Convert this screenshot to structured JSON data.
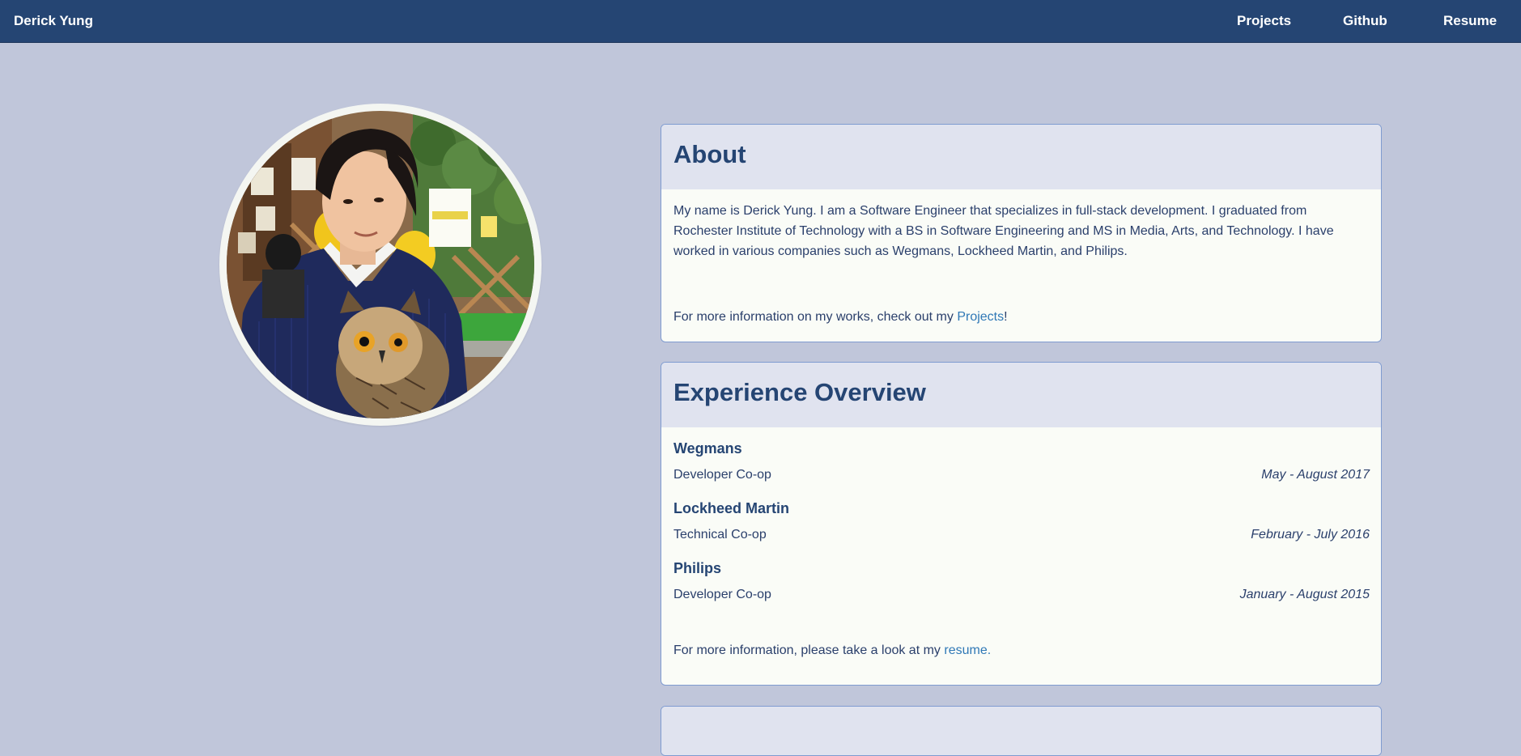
{
  "nav": {
    "brand": "Derick Yung",
    "links": [
      "Projects",
      "Github",
      "Resume"
    ]
  },
  "profile": {
    "photo_alt": "Derick Yung holding an owl"
  },
  "about": {
    "title": "About",
    "paragraph": "My name is Derick Yung. I am a Software Engineer that specializes in full-stack development. I graduated from Rochester Institute of Technology with a BS in Software Engineering and MS in Media, Arts, and Technology. I have worked in various companies such as Wegmans, Lockheed Martin, and Philips.",
    "more_prefix": "For more information on my works, check out my ",
    "more_link": "Projects",
    "more_suffix": "!"
  },
  "experience": {
    "title": "Experience Overview",
    "jobs": [
      {
        "company": "Wegmans",
        "role": "Developer Co-op",
        "dates": "May - August 2017"
      },
      {
        "company": "Lockheed Martin",
        "role": "Technical Co-op",
        "dates": "February - July 2016"
      },
      {
        "company": "Philips",
        "role": "Developer Co-op",
        "dates": "January - August 2015"
      }
    ],
    "more_prefix": "For more information, please take a look at my ",
    "more_link": "resume."
  },
  "colors": {
    "navbar": "#254573",
    "page_bg": "#c0c6da",
    "card_header": "#e0e3ef",
    "card_body": "#fafcf7",
    "link": "#2f78b6"
  }
}
